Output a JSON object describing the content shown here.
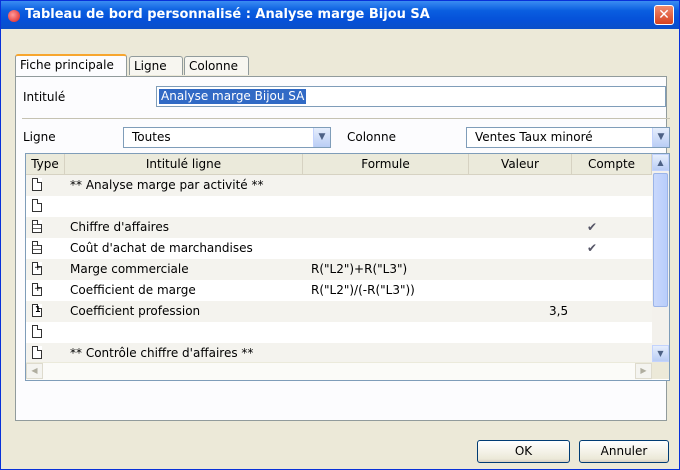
{
  "window": {
    "title": "Tableau de bord personnalisé : Analyse marge Bijou SA",
    "close_glyph": "✕"
  },
  "tabs": [
    {
      "label": "Fiche principale",
      "active": true
    },
    {
      "label": "Ligne",
      "active": false
    },
    {
      "label": "Colonne",
      "active": false
    }
  ],
  "form": {
    "intitule_label": "Intitulé",
    "intitule_value": "Analyse marge Bijou SA",
    "ligne_label": "Ligne",
    "ligne_value": "Toutes",
    "colonne_label": "Colonne",
    "colonne_value": "Ventes Taux minoré"
  },
  "table": {
    "columns": [
      "Type",
      "Intitulé ligne",
      "Formule",
      "Valeur",
      "Compte"
    ],
    "rows": [
      {
        "icon": "blank-doc-icon",
        "label": "** Analyse marge par activité **",
        "formule": "",
        "valeur": "",
        "compte": "",
        "shaded": true
      },
      {
        "icon": "blank-doc-icon",
        "label": "",
        "formule": "",
        "valeur": "",
        "compte": "",
        "shaded": false
      },
      {
        "icon": "lines-doc-icon",
        "label": "Chiffre d'affaires",
        "formule": "",
        "valeur": "",
        "compte": "✔",
        "shaded": true
      },
      {
        "icon": "lines-doc-icon",
        "label": "Coût d'achat de marchandises",
        "formule": "",
        "valeur": "",
        "compte": "✔",
        "shaded": false
      },
      {
        "icon": "calc-doc-icon",
        "label": "Marge commerciale",
        "formule": "R(\"L2\")+R(\"L3\")",
        "valeur": "",
        "compte": "",
        "shaded": true
      },
      {
        "icon": "calc-doc-icon",
        "label": "Coefficient de marge",
        "formule": "R(\"L2\")/(-R(\"L3\"))",
        "valeur": "",
        "compte": "",
        "shaded": false
      },
      {
        "icon": "number-doc-icon",
        "label": "Coefficient profession",
        "formule": "",
        "valeur": "3,5",
        "compte": "",
        "shaded": true
      },
      {
        "icon": "blank-doc-icon",
        "label": "",
        "formule": "",
        "valeur": "",
        "compte": "",
        "shaded": false
      },
      {
        "icon": "blank-doc-icon",
        "label": "** Contrôle chiffre d'affaires **",
        "formule": "",
        "valeur": "",
        "compte": "",
        "shaded": true
      }
    ]
  },
  "buttons": {
    "ok": "OK",
    "cancel": "Annuler"
  },
  "colors": {
    "titlebar": "#0a5ee0",
    "selection": "#316ac5",
    "tab_accent": "#f7a62f"
  }
}
